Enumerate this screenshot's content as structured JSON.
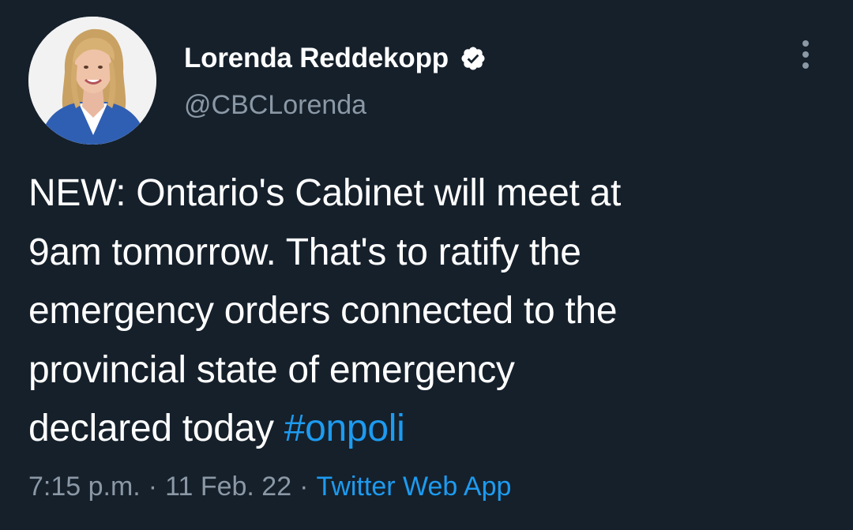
{
  "author": {
    "display_name": "Lorenda Reddekopp",
    "handle": "@CBCLorenda",
    "verified": true,
    "avatar_icon": "profile-photo"
  },
  "tweet": {
    "lines": [
      "NEW: Ontario's Cabinet will meet at",
      "9am tomorrow. That's to ratify the",
      "emergency orders connected to the",
      "provincial state of emergency",
      "declared today"
    ],
    "hashtag": "#onpoli"
  },
  "meta": {
    "time": "7:15 p.m.",
    "separator": "·",
    "date": "11 Feb. 22",
    "source": "Twitter Web App"
  },
  "colors": {
    "background": "#15202b",
    "text": "#ffffff",
    "secondary": "#8b98a5",
    "accent": "#1d9bf0"
  },
  "icons": {
    "verified": "verified-badge-icon",
    "more": "more-vertical-icon"
  }
}
